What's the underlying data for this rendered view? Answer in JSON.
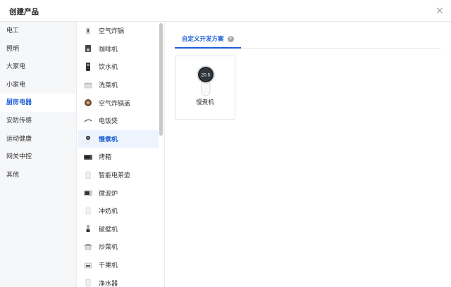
{
  "dialog": {
    "title": "创建产品"
  },
  "categories": [
    {
      "label": "电工",
      "active": false
    },
    {
      "label": "照明",
      "active": false
    },
    {
      "label": "大家电",
      "active": false
    },
    {
      "label": "小家电",
      "active": false
    },
    {
      "label": "厨房电器",
      "active": true
    },
    {
      "label": "安防传感",
      "active": false
    },
    {
      "label": "运动健康",
      "active": false
    },
    {
      "label": "网关中控",
      "active": false
    },
    {
      "label": "其他",
      "active": false
    }
  ],
  "products": [
    {
      "label": "空气炸锅",
      "icon": "air-fryer-icon",
      "active": false
    },
    {
      "label": "咖啡机",
      "icon": "coffee-machine-icon",
      "active": false
    },
    {
      "label": "饮水机",
      "icon": "water-dispenser-icon",
      "active": false
    },
    {
      "label": "洗菜机",
      "icon": "vegetable-washer-icon",
      "active": false
    },
    {
      "label": "空气炸锅盖",
      "icon": "air-fryer-lid-icon",
      "active": false
    },
    {
      "label": "电饭煲",
      "icon": "rice-cooker-icon",
      "active": false
    },
    {
      "label": "慢煮机",
      "icon": "sous-vide-icon",
      "active": true
    },
    {
      "label": "烤箱",
      "icon": "oven-icon",
      "active": false
    },
    {
      "label": "智能电茶壶",
      "icon": "smart-kettle-icon",
      "active": false
    },
    {
      "label": "微波炉",
      "icon": "microwave-icon",
      "active": false
    },
    {
      "label": "冲奶机",
      "icon": "formula-maker-icon",
      "active": false
    },
    {
      "label": "破壁机",
      "icon": "blender-icon",
      "active": false
    },
    {
      "label": "炒菜机",
      "icon": "cooking-robot-icon",
      "active": false
    },
    {
      "label": "干果机",
      "icon": "dried-fruit-machine-icon",
      "active": false
    },
    {
      "label": "净水器",
      "icon": "water-purifier-icon",
      "active": false
    }
  ],
  "detail": {
    "tab_label": "自定义开发方案",
    "help_glyph": "?",
    "card": {
      "label": "慢煮机",
      "display_value": "20.5"
    }
  },
  "colors": {
    "accent": "#1c5fd8",
    "active_bg": "#eef4fd",
    "sidebar_bg": "#f6f7f9"
  }
}
